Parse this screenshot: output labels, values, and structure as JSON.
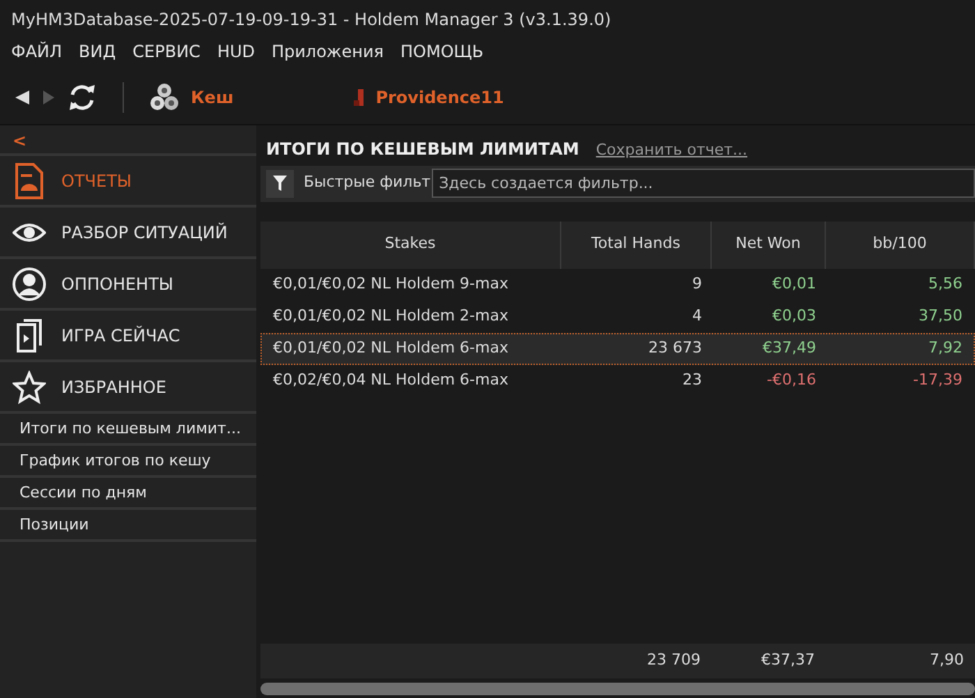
{
  "window": {
    "title": "MyHM3Database-2025-07-19-09-19-31 - Holdem Manager 3 (v3.1.39.0)"
  },
  "menu": [
    "ФАЙЛ",
    "ВИД",
    "СЕРВИС",
    "HUD",
    "Приложения",
    "ПОМОЩЬ"
  ],
  "toolbar": {
    "game": "Кеш",
    "player": "Providence11"
  },
  "sidebar": {
    "collapse": "<",
    "items": [
      {
        "kind": "reports",
        "label": "ОТЧЕТЫ",
        "selected": true
      },
      {
        "kind": "situations",
        "label": "РАЗБОР СИТУАЦИЙ",
        "selected": false
      },
      {
        "kind": "opponents",
        "label": "ОППОНЕНТЫ",
        "selected": false
      },
      {
        "kind": "live",
        "label": "ИГРА СЕЙЧАС",
        "selected": false
      },
      {
        "kind": "favorites",
        "label": "ИЗБРАННОЕ",
        "selected": false
      }
    ],
    "reports": [
      "Итоги по кешевым лимит...",
      "График итогов по кешу",
      "Сессии по дням",
      "Позиции"
    ]
  },
  "report": {
    "title": "ИТОГИ ПО КЕШЕВЫМ ЛИМИТАМ",
    "save_link": "Сохранить отчет...",
    "filter_label": "Быстрые фильт",
    "filter_placeholder": "Здесь создается фильтр..."
  },
  "table": {
    "columns": [
      "Stakes",
      "Total Hands",
      "Net Won",
      "bb/100"
    ],
    "rows": [
      {
        "cells": [
          "€0,01/€0,02 NL Holdem 9-max",
          "9",
          "€0,01",
          "5,56"
        ],
        "color": "#8fd18f",
        "selected": false
      },
      {
        "cells": [
          "€0,01/€0,02 NL Holdem 2-max",
          "4",
          "€0,03",
          "37,50"
        ],
        "color": "#8fd18f",
        "selected": false
      },
      {
        "cells": [
          "€0,01/€0,02 NL Holdem 6-max",
          "23 673",
          "€37,49",
          "7,92"
        ],
        "color": "#8fd18f",
        "selected": true
      },
      {
        "cells": [
          "€0,02/€0,04 NL Holdem 6-max",
          "23",
          "-€0,16",
          "-17,39"
        ],
        "color": "#e07070",
        "selected": false
      }
    ],
    "totals": {
      "total_hands": "23 709",
      "net_won": "€37,37",
      "bb_100": "7,90"
    }
  }
}
